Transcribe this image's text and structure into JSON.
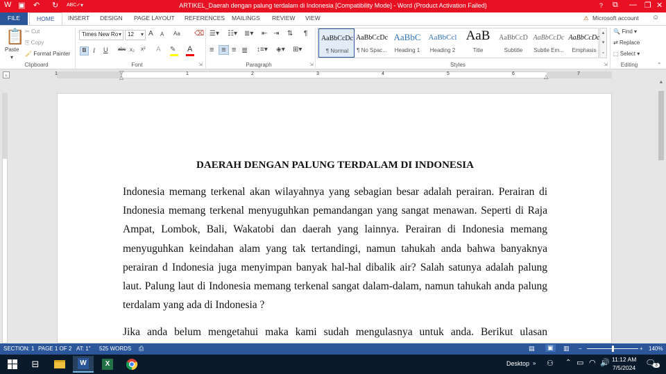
{
  "window": {
    "title": "ARTIKEL_Daerah dengan palung terdalam di Indonesia [Compatibility Mode] - Word (Product Activation Failed)",
    "help": "?"
  },
  "tabs": [
    "FILE",
    "HOME",
    "INSERT",
    "DESIGN",
    "PAGE LAYOUT",
    "REFERENCES",
    "MAILINGS",
    "REVIEW",
    "VIEW"
  ],
  "account": "Microsoft account",
  "clipboard": {
    "paste": "Paste",
    "cut": "Cut",
    "copy": "Copy",
    "format_painter": "Format Painter",
    "label": "Clipboard"
  },
  "font": {
    "name": "Times New Ro",
    "size": "12",
    "grow": "A",
    "shrink": "A",
    "case": "Aa",
    "label": "Font",
    "bold": "B",
    "italic": "I",
    "underline": "U",
    "strike": "abc",
    "sub": "x₂",
    "sup": "x²"
  },
  "paragraph": {
    "label": "Paragraph"
  },
  "styles": {
    "label": "Styles",
    "items": [
      {
        "preview": "AaBbCcDc",
        "name": "¶ Normal"
      },
      {
        "preview": "AaBbCcDc",
        "name": "¶ No Spac..."
      },
      {
        "preview": "AaBbC",
        "name": "Heading 1"
      },
      {
        "preview": "AaBbCcl",
        "name": "Heading 2"
      },
      {
        "preview": "AaB",
        "name": "Title"
      },
      {
        "preview": "AaBbCcD",
        "name": "Subtitle"
      },
      {
        "preview": "AaBbCcDc",
        "name": "Subtle Em..."
      },
      {
        "preview": "AaBbCcDc",
        "name": "Emphasis"
      }
    ]
  },
  "editing": {
    "find": "Find",
    "replace": "Replace",
    "select": "Select",
    "label": "Editing"
  },
  "ruler": {
    "numbers": [
      "1",
      "1",
      "2",
      "3",
      "4",
      "5",
      "6",
      "7"
    ]
  },
  "document": {
    "title": "DAERAH DENGAN PALUNG TERDALAM DI INDONESIA",
    "p1": [
      "Indonesia memang terkenal akan wilayahnya yang sebagian besar adalah perairan. Perairan di",
      "Indonesia memang terkenal menyuguhkan pemandangan yang sangat menawan. Seperti di Raja",
      "Ampat, Lombok, Bali, Wakatobi dan daerah yang lainnya. Perairan di Indonesia memang",
      "menyuguhkan keindahan alam yang tak tertandingi, namun tahukah anda bahwa banyaknya",
      "perairan d Indonesia juga menyimpan banyak hal-hal dibalik air? Salah satunya adalah palung",
      "laut. Palung laut di Indonesia memang terkenal sangat dalam-dalam, namun tahukah anda palung",
      "terdalam yang ada di Indonesia ?"
    ],
    "p2": [
      "Jika anda belum mengetahui maka kami sudah mengulasnya untuk anda. Berikut ulasan"
    ]
  },
  "status": {
    "section": "SECTION: 1",
    "page": "PAGE 1 OF 2",
    "at": "AT: 1\"",
    "words": "525 WORDS",
    "zoom": "140%"
  },
  "taskbar": {
    "desktop": "Desktop",
    "time": "11:12 AM",
    "date": "7/5/2024",
    "notifications": "3"
  }
}
